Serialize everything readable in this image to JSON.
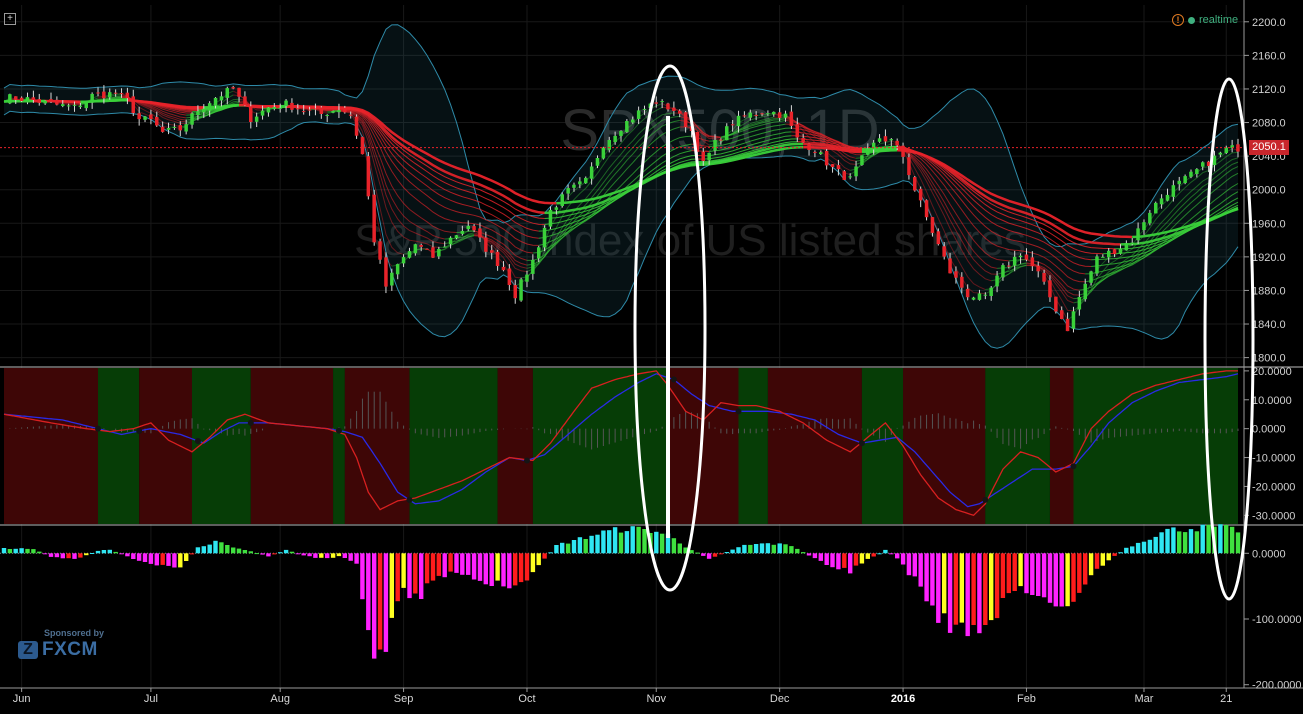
{
  "header": {
    "realtime_label": "realtime",
    "alert_icon": "!",
    "expand_icon": "+"
  },
  "watermark": {
    "symbol": "SPX500, 1D",
    "description": "S&P 500 index of US listed shares"
  },
  "sponsor": {
    "label": "Sponsored by",
    "brand": "FXCM",
    "logo": "Z"
  },
  "colors": {
    "bull": "#3ad13a",
    "bear": "#e8232a",
    "band": "#2e8aa8",
    "blue_line": "#2a2ae6",
    "red_line": "#d82020",
    "hist_cyan": "#2fe6f2",
    "hist_green": "#3fe03f",
    "hist_yellow": "#ffff22",
    "hist_red": "#ff1c1c",
    "hist_magenta": "#ff22ff",
    "bg_green": "#063d06",
    "bg_red": "#3e0606",
    "ellipse": "#ffffff"
  },
  "chart_data": [
    {
      "type": "candlestick",
      "panel": "price",
      "title": "SPX500, 1D",
      "subtitle": "S&P 500 index of US listed shares",
      "last_price": "2050.1",
      "ylim": [
        1790,
        2220
      ],
      "y_ticks": [
        "2200.0",
        "2160.0",
        "2120.0",
        "2080.0",
        "2040.0",
        "2000.0",
        "1960.0",
        "1920.0",
        "1880.0",
        "1840.0",
        "1800.0"
      ],
      "y_tick_values": [
        2200,
        2160,
        2120,
        2080,
        2040,
        2000,
        1960,
        1920,
        1880,
        1840,
        1800
      ],
      "x_range": [
        0,
        210
      ],
      "x_labels": [
        {
          "label": "Jun",
          "x": 3
        },
        {
          "label": "Jul",
          "x": 25
        },
        {
          "label": "Aug",
          "x": 47
        },
        {
          "label": "Sep",
          "x": 68
        },
        {
          "label": "Oct",
          "x": 89
        },
        {
          "label": "Nov",
          "x": 111
        },
        {
          "label": "Dec",
          "x": 132
        },
        {
          "label": "2016",
          "x": 153,
          "bold": true
        },
        {
          "label": "Feb",
          "x": 174
        },
        {
          "label": "Mar",
          "x": 194
        },
        {
          "label": "21",
          "x": 208
        }
      ],
      "anchors": [
        [
          0,
          2110
        ],
        [
          4,
          2108
        ],
        [
          8,
          2102
        ],
        [
          12,
          2098
        ],
        [
          15,
          2112
        ],
        [
          19,
          2115
        ],
        [
          21,
          2106
        ],
        [
          23,
          2084
        ],
        [
          25,
          2082
        ],
        [
          27,
          2068
        ],
        [
          30,
          2072
        ],
        [
          33,
          2095
        ],
        [
          36,
          2110
        ],
        [
          39,
          2120
        ],
        [
          42,
          2085
        ],
        [
          45,
          2098
        ],
        [
          48,
          2102
        ],
        [
          51,
          2095
        ],
        [
          54,
          2090
        ],
        [
          57,
          2097
        ],
        [
          59,
          2090
        ],
        [
          61,
          2042
        ],
        [
          63,
          1940
        ],
        [
          65,
          1885
        ],
        [
          67,
          1910
        ],
        [
          70,
          1935
        ],
        [
          73,
          1920
        ],
        [
          76,
          1942
        ],
        [
          79,
          1958
        ],
        [
          82,
          1930
        ],
        [
          85,
          1905
        ],
        [
          87,
          1875
        ],
        [
          90,
          1915
        ],
        [
          93,
          1975
        ],
        [
          96,
          1998
        ],
        [
          99,
          2010
        ],
        [
          102,
          2055
        ],
        [
          105,
          2075
        ],
        [
          108,
          2092
        ],
        [
          111,
          2105
        ],
        [
          114,
          2095
        ],
        [
          117,
          2070
        ],
        [
          119,
          2030
        ],
        [
          121,
          2055
        ],
        [
          124,
          2080
        ],
        [
          127,
          2090
        ],
        [
          130,
          2094
        ],
        [
          133,
          2088
        ],
        [
          135,
          2060
        ],
        [
          138,
          2048
        ],
        [
          141,
          2025
        ],
        [
          144,
          2012
        ],
        [
          146,
          2036
        ],
        [
          149,
          2062
        ],
        [
          151,
          2058
        ],
        [
          153,
          2040
        ],
        [
          155,
          2000
        ],
        [
          158,
          1950
        ],
        [
          161,
          1902
        ],
        [
          164,
          1875
        ],
        [
          167,
          1870
        ],
        [
          170,
          1906
        ],
        [
          173,
          1925
        ],
        [
          176,
          1900
        ],
        [
          179,
          1858
        ],
        [
          181,
          1835
        ],
        [
          183,
          1872
        ],
        [
          186,
          1918
        ],
        [
          189,
          1928
        ],
        [
          192,
          1940
        ],
        [
          195,
          1975
        ],
        [
          198,
          1998
        ],
        [
          201,
          2012
        ],
        [
          204,
          2028
        ],
        [
          206,
          2038
        ],
        [
          208,
          2048
        ],
        [
          210,
          2050
        ]
      ],
      "indicators": [
        "Bollinger Bands",
        "Guppy multiple moving averages"
      ]
    },
    {
      "type": "line",
      "panel": "oscillator",
      "ylim": [
        -33,
        21
      ],
      "y_ticks": [
        "20.0000",
        "10.0000",
        "0.0000",
        "-10.0000",
        "-20.0000",
        "-30.0000"
      ],
      "y_tick_values": [
        20,
        10,
        0,
        -10,
        -20,
        -30
      ],
      "series": [
        {
          "color": "#2a2ae6",
          "values": [
            [
              0,
              5
            ],
            [
              10,
              3
            ],
            [
              20,
              -2
            ],
            [
              25,
              0
            ],
            [
              30,
              -2
            ],
            [
              34,
              -5
            ],
            [
              37,
              -1
            ],
            [
              40,
              2
            ],
            [
              45,
              2
            ],
            [
              50,
              1
            ],
            [
              55,
              0
            ],
            [
              58,
              -1
            ],
            [
              61,
              -3
            ],
            [
              64,
              -12
            ],
            [
              67,
              -22
            ],
            [
              70,
              -26
            ],
            [
              74,
              -25
            ],
            [
              78,
              -21
            ],
            [
              82,
              -15
            ],
            [
              86,
              -10
            ],
            [
              89,
              -11
            ],
            [
              92,
              -9
            ],
            [
              96,
              -2
            ],
            [
              100,
              5
            ],
            [
              104,
              11
            ],
            [
              108,
              16
            ],
            [
              111,
              19
            ],
            [
              114,
              17
            ],
            [
              117,
              12
            ],
            [
              120,
              8
            ],
            [
              124,
              6
            ],
            [
              127,
              6
            ],
            [
              130,
              6
            ],
            [
              134,
              5
            ],
            [
              138,
              3
            ],
            [
              142,
              -2
            ],
            [
              146,
              -5
            ],
            [
              149,
              -4
            ],
            [
              152,
              -3
            ],
            [
              155,
              -8
            ],
            [
              158,
              -15
            ],
            [
              161,
              -22
            ],
            [
              164,
              -27
            ],
            [
              166,
              -26
            ],
            [
              169,
              -22
            ],
            [
              172,
              -18
            ],
            [
              175,
              -14
            ],
            [
              179,
              -14
            ],
            [
              182,
              -13
            ],
            [
              185,
              -6
            ],
            [
              188,
              2
            ],
            [
              192,
              9
            ],
            [
              196,
              13
            ],
            [
              200,
              16
            ],
            [
              204,
              17
            ],
            [
              208,
              18
            ],
            [
              210,
              19
            ]
          ]
        },
        {
          "color": "#d82020",
          "values": [
            [
              0,
              5
            ],
            [
              8,
              2
            ],
            [
              14,
              0
            ],
            [
              18,
              -1
            ],
            [
              22,
              0
            ],
            [
              25,
              2
            ],
            [
              28,
              -4
            ],
            [
              32,
              -8
            ],
            [
              35,
              -3
            ],
            [
              38,
              3
            ],
            [
              41,
              5
            ],
            [
              45,
              2
            ],
            [
              50,
              1
            ],
            [
              55,
              0
            ],
            [
              58,
              -2
            ],
            [
              60,
              -10
            ],
            [
              62,
              -22
            ],
            [
              64,
              -28
            ],
            [
              67,
              -25
            ],
            [
              70,
              -24
            ],
            [
              74,
              -21
            ],
            [
              78,
              -18
            ],
            [
              82,
              -14
            ],
            [
              86,
              -10
            ],
            [
              90,
              -11
            ],
            [
              93,
              -5
            ],
            [
              97,
              6
            ],
            [
              100,
              14
            ],
            [
              104,
              17
            ],
            [
              108,
              19
            ],
            [
              111,
              20
            ],
            [
              113,
              15
            ],
            [
              116,
              6
            ],
            [
              119,
              3
            ],
            [
              122,
              9
            ],
            [
              125,
              8
            ],
            [
              128,
              8
            ],
            [
              132,
              6
            ],
            [
              136,
              2
            ],
            [
              140,
              -4
            ],
            [
              144,
              -8
            ],
            [
              147,
              -3
            ],
            [
              150,
              2
            ],
            [
              153,
              -6
            ],
            [
              156,
              -16
            ],
            [
              159,
              -24
            ],
            [
              162,
              -28
            ],
            [
              165,
              -30
            ],
            [
              167,
              -26
            ],
            [
              170,
              -14
            ],
            [
              173,
              -8
            ],
            [
              176,
              -10
            ],
            [
              179,
              -15
            ],
            [
              182,
              -12
            ],
            [
              185,
              0
            ],
            [
              188,
              6
            ],
            [
              192,
              12
            ],
            [
              196,
              15
            ],
            [
              200,
              17
            ],
            [
              204,
              19
            ],
            [
              208,
              20
            ],
            [
              210,
              20
            ]
          ]
        }
      ],
      "zones": [
        {
          "from": 0,
          "to": 16,
          "state": "bear"
        },
        {
          "from": 16,
          "to": 23,
          "state": "bull"
        },
        {
          "from": 23,
          "to": 32,
          "state": "bear"
        },
        {
          "from": 32,
          "to": 42,
          "state": "bull"
        },
        {
          "from": 42,
          "to": 56,
          "state": "bear"
        },
        {
          "from": 56,
          "to": 58,
          "state": "bull"
        },
        {
          "from": 58,
          "to": 69,
          "state": "bear"
        },
        {
          "from": 69,
          "to": 84,
          "state": "bull"
        },
        {
          "from": 84,
          "to": 90,
          "state": "bear"
        },
        {
          "from": 90,
          "to": 113,
          "state": "bull"
        },
        {
          "from": 113,
          "to": 125,
          "state": "bear"
        },
        {
          "from": 125,
          "to": 130,
          "state": "bull"
        },
        {
          "from": 130,
          "to": 146,
          "state": "bear"
        },
        {
          "from": 146,
          "to": 153,
          "state": "bull"
        },
        {
          "from": 153,
          "to": 167,
          "state": "bear"
        },
        {
          "from": 167,
          "to": 178,
          "state": "bull"
        },
        {
          "from": 178,
          "to": 182,
          "state": "bear"
        },
        {
          "from": 182,
          "to": 210,
          "state": "bull"
        }
      ],
      "markers": [
        16,
        23,
        33,
        42,
        57,
        69,
        89,
        114,
        125,
        146,
        167,
        182
      ]
    },
    {
      "type": "bar",
      "panel": "histogram",
      "ylim": [
        -205,
        40
      ],
      "y_ticks": [
        "0.0000",
        "-100.0000",
        "-200.0000"
      ],
      "y_tick_values": [
        0,
        -100,
        -200
      ],
      "profile": [
        [
          0,
          8
        ],
        [
          5,
          6
        ],
        [
          8,
          -5
        ],
        [
          12,
          -10
        ],
        [
          14,
          -3
        ],
        [
          16,
          4
        ],
        [
          18,
          6
        ],
        [
          22,
          -8
        ],
        [
          25,
          -15
        ],
        [
          28,
          -20
        ],
        [
          30,
          -25
        ],
        [
          33,
          10
        ],
        [
          36,
          18
        ],
        [
          39,
          8
        ],
        [
          42,
          3
        ],
        [
          45,
          -5
        ],
        [
          48,
          5
        ],
        [
          51,
          -3
        ],
        [
          54,
          -8
        ],
        [
          57,
          -5
        ],
        [
          60,
          -15
        ],
        [
          62,
          -120
        ],
        [
          64,
          -170
        ],
        [
          66,
          -100
        ],
        [
          68,
          -60
        ],
        [
          70,
          -70
        ],
        [
          73,
          -45
        ],
        [
          76,
          -30
        ],
        [
          80,
          -35
        ],
        [
          84,
          -48
        ],
        [
          87,
          -55
        ],
        [
          89,
          -40
        ],
        [
          91,
          -20
        ],
        [
          94,
          12
        ],
        [
          98,
          22
        ],
        [
          102,
          32
        ],
        [
          106,
          38
        ],
        [
          110,
          35
        ],
        [
          113,
          28
        ],
        [
          116,
          10
        ],
        [
          120,
          -8
        ],
        [
          123,
          2
        ],
        [
          126,
          12
        ],
        [
          130,
          15
        ],
        [
          134,
          12
        ],
        [
          138,
          -8
        ],
        [
          141,
          -20
        ],
        [
          144,
          -28
        ],
        [
          147,
          -10
        ],
        [
          150,
          5
        ],
        [
          152,
          -8
        ],
        [
          155,
          -40
        ],
        [
          158,
          -85
        ],
        [
          161,
          -110
        ],
        [
          164,
          -115
        ],
        [
          167,
          -105
        ],
        [
          170,
          -80
        ],
        [
          173,
          -50
        ],
        [
          176,
          -60
        ],
        [
          179,
          -80
        ],
        [
          182,
          -70
        ],
        [
          185,
          -30
        ],
        [
          188,
          -10
        ],
        [
          191,
          8
        ],
        [
          194,
          20
        ],
        [
          198,
          35
        ],
        [
          202,
          38
        ],
        [
          206,
          40
        ],
        [
          208,
          38
        ],
        [
          210,
          35
        ]
      ]
    }
  ]
}
